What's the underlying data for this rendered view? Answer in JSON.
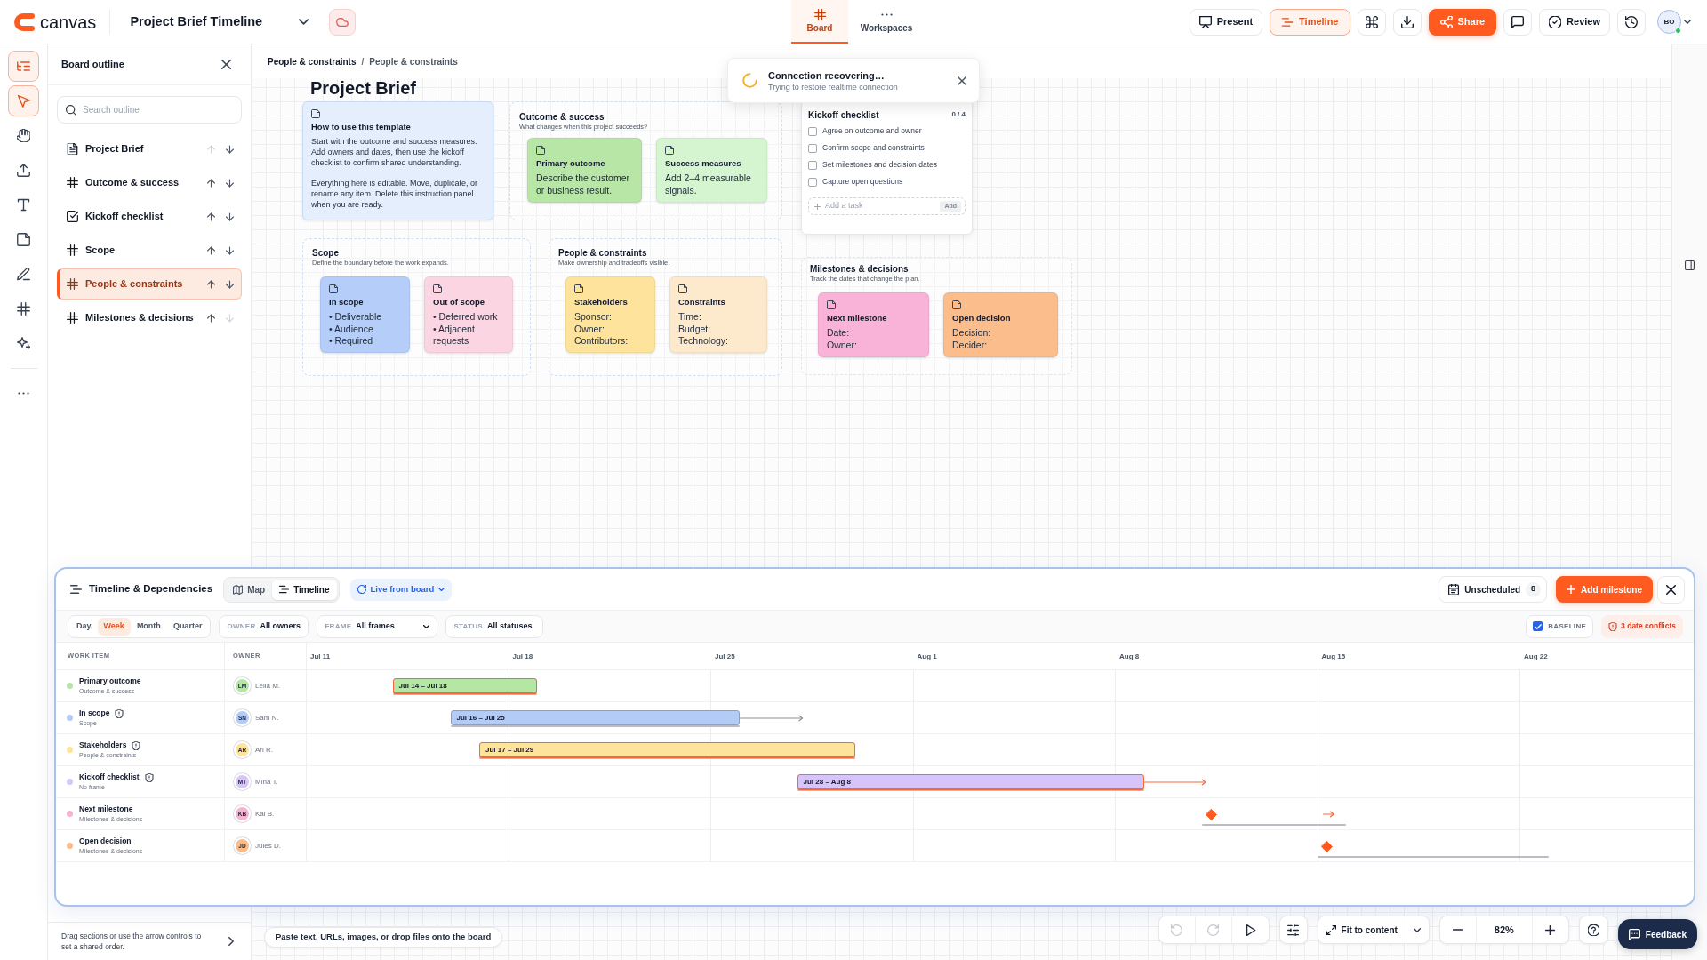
{
  "header": {
    "logo_text": "canvas",
    "title": "Project Brief Timeline",
    "view_tabs": [
      {
        "label": "Board",
        "kind": "board",
        "selected": true
      },
      {
        "label": "Workspaces",
        "kind": "workspaces",
        "selected": false
      }
    ],
    "actions": [
      {
        "kind": "present",
        "label": "Present",
        "active": false
      },
      {
        "kind": "timeline",
        "label": "Timeline",
        "active": true
      },
      {
        "kind": "command",
        "active": false
      },
      {
        "kind": "download",
        "active": false
      },
      {
        "kind": "share",
        "label": "Share",
        "active": false
      },
      {
        "kind": "comments",
        "active": false
      },
      {
        "kind": "review",
        "label": "Review",
        "active": false
      },
      {
        "kind": "history",
        "active": false
      }
    ],
    "avatar": {
      "initials": "BO",
      "online": true
    }
  },
  "tools": [
    {
      "kind": "outline",
      "selected": true
    },
    {
      "kind": "select",
      "selected": true
    },
    {
      "kind": "hand",
      "selected": false
    },
    {
      "kind": "upload",
      "selected": false
    },
    {
      "kind": "text",
      "selected": false
    },
    {
      "kind": "note",
      "selected": false
    },
    {
      "kind": "pen",
      "selected": false
    },
    {
      "kind": "frame",
      "selected": false
    },
    {
      "kind": "ai",
      "selected": false
    },
    {
      "kind": "more",
      "selected": false
    }
  ],
  "outline": {
    "title": "Board outline",
    "search": {
      "placeholder": "Search outline"
    },
    "items": [
      {
        "label": "Project Brief",
        "kind": "document",
        "selected": false,
        "up_disabled": true,
        "down_disabled": false
      },
      {
        "label": "Outcome & success",
        "kind": "frame",
        "selected": false,
        "up_disabled": false,
        "down_disabled": false
      },
      {
        "label": "Kickoff checklist",
        "kind": "checklist",
        "selected": false,
        "up_disabled": false,
        "down_disabled": false
      },
      {
        "label": "Scope",
        "kind": "frame",
        "selected": false,
        "up_disabled": false,
        "down_disabled": false
      },
      {
        "label": "People & constraints",
        "kind": "frame",
        "selected": true,
        "up_disabled": false,
        "down_disabled": false
      },
      {
        "label": "Milestones & decisions",
        "kind": "frame",
        "selected": false,
        "up_disabled": false,
        "down_disabled": true
      }
    ],
    "hint": "Drag sections or use the arrow controls to set a shared order."
  },
  "breadcrumb": {
    "items": [
      "People & constraints",
      "People & constraints"
    ],
    "separator": "/"
  },
  "toast": {
    "title": "Connection recovering…",
    "message": "Trying to restore realtime connection"
  },
  "board": {
    "title": "Project Brief",
    "instructions": {
      "title": "How to use this template",
      "paragraphs": [
        "Start with the outcome and success measures. Add owners and dates, then use the kickoff checklist to confirm shared understanding.",
        "Everything here is editable. Move, duplicate, or rename any item. Delete this instruction panel when you are ready."
      ]
    },
    "frames": [
      {
        "title": "Outcome & success",
        "subtitle": "What changes when this project succeeds?",
        "notes": [
          {
            "title": "Primary outcome",
            "lines": [
              "Describe the customer or business result."
            ],
            "color": "#b8e6a7"
          },
          {
            "title": "Success measures",
            "lines": [
              "Add 2–4 measurable signals."
            ],
            "color": "#d5f5d1"
          }
        ]
      },
      {
        "title": "Scope",
        "subtitle": "Define the boundary before the work expands.",
        "notes": [
          {
            "title": "In scope",
            "lines": [
              "• Deliverable",
              "• Audience",
              "• Required"
            ],
            "color": "#b5cef9"
          },
          {
            "title": "Out of scope",
            "lines": [
              "• Deferred work",
              "• Adjacent requests"
            ],
            "color": "#fcd5e2"
          }
        ]
      },
      {
        "title": "People & constraints",
        "subtitle": "Make ownership and tradeoffs visible.",
        "notes": [
          {
            "title": "Stakeholders",
            "lines": [
              "Sponsor:",
              "Owner:",
              "Contributors:"
            ],
            "color": "#fde39c"
          },
          {
            "title": "Constraints",
            "lines": [
              "Time:",
              "Budget:",
              "Technology:"
            ],
            "color": "#fde9cc"
          }
        ]
      },
      {
        "title": "Milestones & decisions",
        "subtitle": "Track the dates that change the plan.",
        "notes": [
          {
            "title": "Next milestone",
            "lines": [
              "Date:",
              "Owner:"
            ],
            "color": "#f9b3d9"
          },
          {
            "title": "Open decision",
            "lines": [
              "Decision:",
              "Decider:"
            ],
            "color": "#fbbd8b"
          }
        ]
      }
    ],
    "checklist": {
      "title": "Kickoff checklist",
      "progress": "0 / 4",
      "items": [
        {
          "label": "Agree on outcome and owner",
          "checked": false
        },
        {
          "label": "Confirm scope and constraints",
          "checked": false
        },
        {
          "label": "Set milestones and decision dates",
          "checked": false
        },
        {
          "label": "Capture open questions",
          "checked": false
        }
      ],
      "add_field": {
        "placeholder": "Add a task"
      },
      "add_button": {
        "label": "Add",
        "disabled": true
      }
    }
  },
  "timeline": {
    "title": "Timeline & Dependencies",
    "views": [
      {
        "label": "Map",
        "kind": "map",
        "selected": false
      },
      {
        "label": "Timeline",
        "kind": "timeline",
        "selected": true
      }
    ],
    "source": "Live from board",
    "unscheduled": {
      "label": "Unscheduled",
      "count": "8"
    },
    "add_button": "Add milestone",
    "scales": [
      {
        "label": "Day",
        "selected": false
      },
      {
        "label": "Week",
        "selected": true
      },
      {
        "label": "Month",
        "selected": false
      },
      {
        "label": "Quarter",
        "selected": false
      }
    ],
    "filters": [
      {
        "label": "OWNER",
        "value": "All owners"
      },
      {
        "label": "FRAME",
        "value": "All frames"
      },
      {
        "label": "STATUS",
        "value": "All statuses"
      }
    ],
    "baseline": {
      "label": "BASELINE",
      "checked": true
    },
    "conflicts": "3 date conflicts",
    "columns": [
      "WORK ITEM",
      "OWNER"
    ],
    "dates": [
      "Jul 11",
      "Jul 18",
      "Jul 25",
      "Aug 1",
      "Aug 8",
      "Aug 15",
      "Aug 22"
    ],
    "rows": [
      {
        "name": "Primary outcome",
        "frame": "Outcome & success",
        "color": "#b5e6a4",
        "warning": false,
        "owner": {
          "initials": "LM",
          "name": "Leila M."
        },
        "item": {
          "kind": "bar",
          "label": "Jul 14 – Jul 18",
          "conflict": true
        }
      },
      {
        "name": "In scope",
        "frame": "Scope",
        "color": "#b3ccf7",
        "warning": true,
        "owner": {
          "initials": "SN",
          "name": "Sam N."
        },
        "item": {
          "kind": "bar",
          "label": "Jul 16 – Jul 25",
          "conflict": false,
          "dependency": {
            "conflict": false
          }
        }
      },
      {
        "name": "Stakeholders",
        "frame": "People & constraints",
        "color": "#fde39b",
        "warning": true,
        "owner": {
          "initials": "AR",
          "name": "Ari R."
        },
        "item": {
          "kind": "bar",
          "label": "Jul 17 – Jul 29",
          "conflict": true
        }
      },
      {
        "name": "Kickoff checklist",
        "frame": "No frame",
        "color": "#d6c4fa",
        "warning": true,
        "owner": {
          "initials": "MT",
          "name": "Mina T."
        },
        "item": {
          "kind": "bar",
          "label": "Jul 28 – Aug 8",
          "conflict": true,
          "dependency": {
            "conflict": true
          }
        }
      },
      {
        "name": "Next milestone",
        "frame": "Milestones & decisions",
        "color": "#f8b2d2",
        "warning": false,
        "owner": {
          "initials": "KB",
          "name": "Kai B."
        },
        "item": {
          "kind": "milestone",
          "dependency": {
            "conflict": true
          }
        }
      },
      {
        "name": "Open decision",
        "frame": "Milestones & decisions",
        "color": "#fbbb88",
        "warning": false,
        "owner": {
          "initials": "JD",
          "name": "Jules D."
        },
        "item": {
          "kind": "milestone"
        }
      }
    ]
  },
  "canvas_controls": {
    "paste_hint": "Paste text, URLs, images, or drop files onto the board",
    "history": [
      {
        "kind": "undo",
        "disabled": true
      },
      {
        "kind": "redo",
        "disabled": true
      },
      {
        "kind": "play",
        "disabled": false
      }
    ],
    "fit": "Fit to content",
    "zoom": "82%",
    "feedback": "Feedback"
  }
}
